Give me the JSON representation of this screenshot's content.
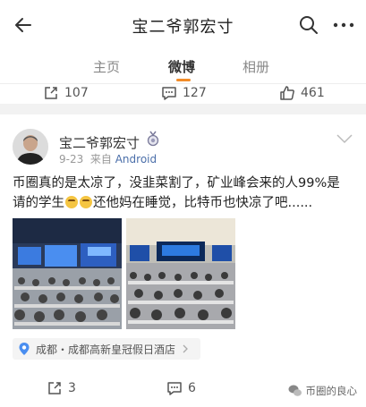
{
  "header": {
    "title": "宝二爷郭宏寸",
    "back_icon": "back-arrow-icon",
    "search_icon": "search-icon",
    "more_icon": "more-icon"
  },
  "tabs": [
    {
      "label": "主页",
      "active": false
    },
    {
      "label": "微博",
      "active": true
    },
    {
      "label": "相册",
      "active": false
    }
  ],
  "accent_color": "#f28c28",
  "previous_post": {
    "reposts": "107",
    "comments": "127",
    "likes": "461"
  },
  "post": {
    "author": "宝二爷郭宏寸",
    "date": "9-23",
    "source_prefix": "来自",
    "source": "Android",
    "text_part1": "币圈真的是太凉了，没韭菜割了，矿业峰会来的人99%是请的学生",
    "text_part2": "还他妈在睡觉，比特币也快凉了吧......",
    "emoji": "laugh-cry-emoji",
    "location": "成都・成都高新皇冠假日酒店",
    "reposts": "3",
    "comments": "6",
    "likes_icon": "like-icon"
  },
  "watermark": "币圈的良心"
}
